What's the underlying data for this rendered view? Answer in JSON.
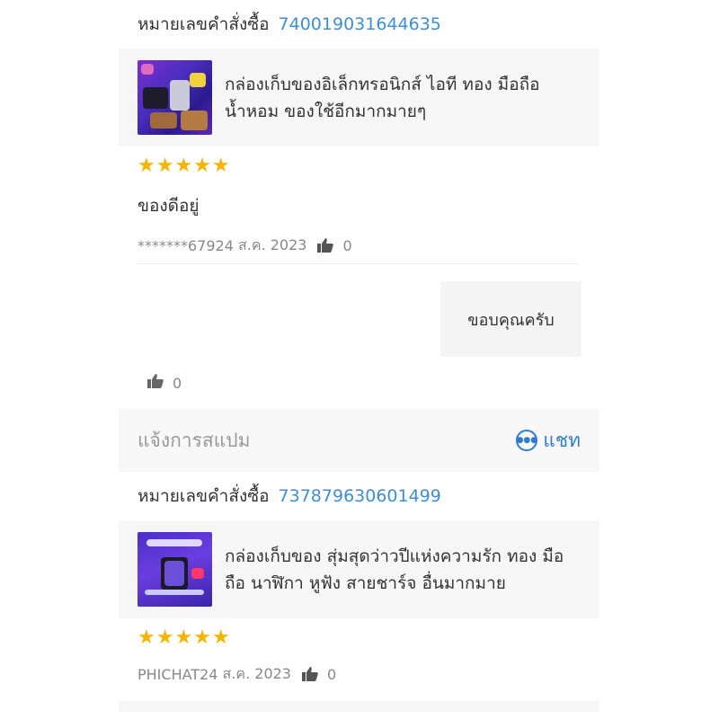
{
  "reviews": [
    {
      "order_label": "หมายเลขคำสั่งซื้อ",
      "order_number": "740019031644635",
      "product_title": "กล่องเก็บของอิเล็กทรอนิกส์ ไอที ทอง มือถือ น้ำหอม ของใช้อีกมากมายๆ",
      "rating": 5,
      "stars": "★★★★★",
      "text": "ของดีอยู่",
      "user": "*******67924",
      "date": "ส.ค. 2023",
      "likes": "0",
      "seller_reply": "ขอบคุณครับ",
      "reply_likes": "0"
    },
    {
      "order_label": "หมายเลขคำสั่งซื้อ",
      "order_number": "737879630601499",
      "product_title": "กล่องเก็บของ สุ่มสุดว่าวปีแห่งความรัก ทอง มือถือ นาฬิกา หูฟัง สายชาร์จ อื่นมากมาย",
      "rating": 5,
      "stars": "★★★★★",
      "user": "PHICHAT24",
      "date": "ส.ค. 2023",
      "likes": "0"
    }
  ],
  "actions": {
    "report_spam": "แจ้งการสแปม",
    "chat": "แชท"
  },
  "icons": {
    "like": "thumbs-up-icon",
    "chat": "chat-bubble-icon",
    "star": "star-icon"
  },
  "colors": {
    "accent": "#3e8ed6",
    "star": "#f5b400",
    "chat": "#2f7bd0"
  }
}
